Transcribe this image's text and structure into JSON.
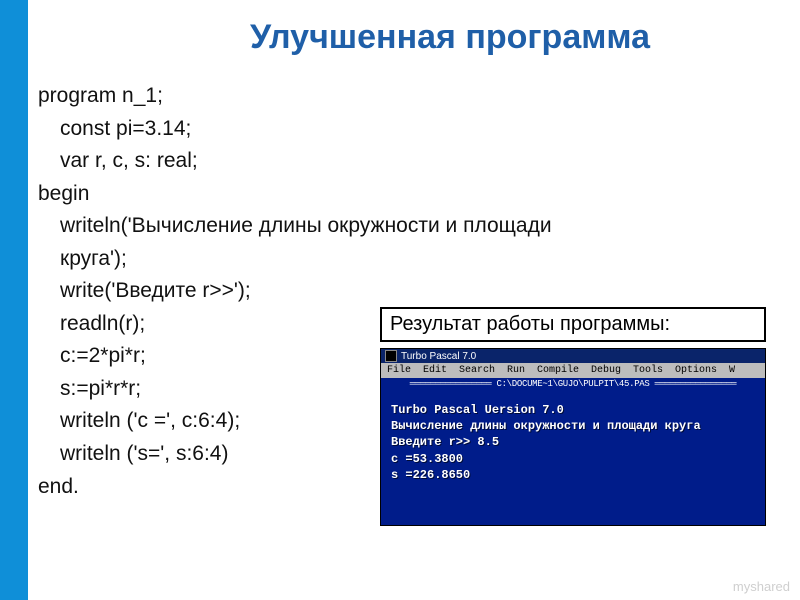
{
  "title": "Улучшенная программа",
  "code": {
    "l1": "program n_1;",
    "l2": "const pi=3.14;",
    "l3": "var r, c, s: real;",
    "l4": "begin",
    "l5": "writeln('Вычисление длины окружности и площади круга');",
    "l6": "write('Введите r>>');",
    "l7": "readln(r);",
    "l8": "c:=2*pi*r;",
    "l9": "s:=pi*r*r;",
    "l10": "writeln ('c =', c:6:4);",
    "l11": "writeln ('s=', s:6:4)",
    "l12": "end."
  },
  "result_label": "Результат работы программы:",
  "terminal": {
    "window_title": "Turbo Pascal 7.0",
    "menubar": "File  Edit  Search  Run  Compile  Debug  Tools  Options  W",
    "pathline": "════════════════ C:\\DOCUME~1\\GUJO\\PULPIT\\45.PAS ════════════════",
    "line1": "Turbo Pascal   Uersion 7.0",
    "line2": "Вычисление длины окружности и площади круга",
    "line3_prompt": "Введите r>>",
    "line3_value": " 8.5",
    "line4": "c =53.3800",
    "line5": "s =226.8650"
  },
  "watermark": "myshared"
}
